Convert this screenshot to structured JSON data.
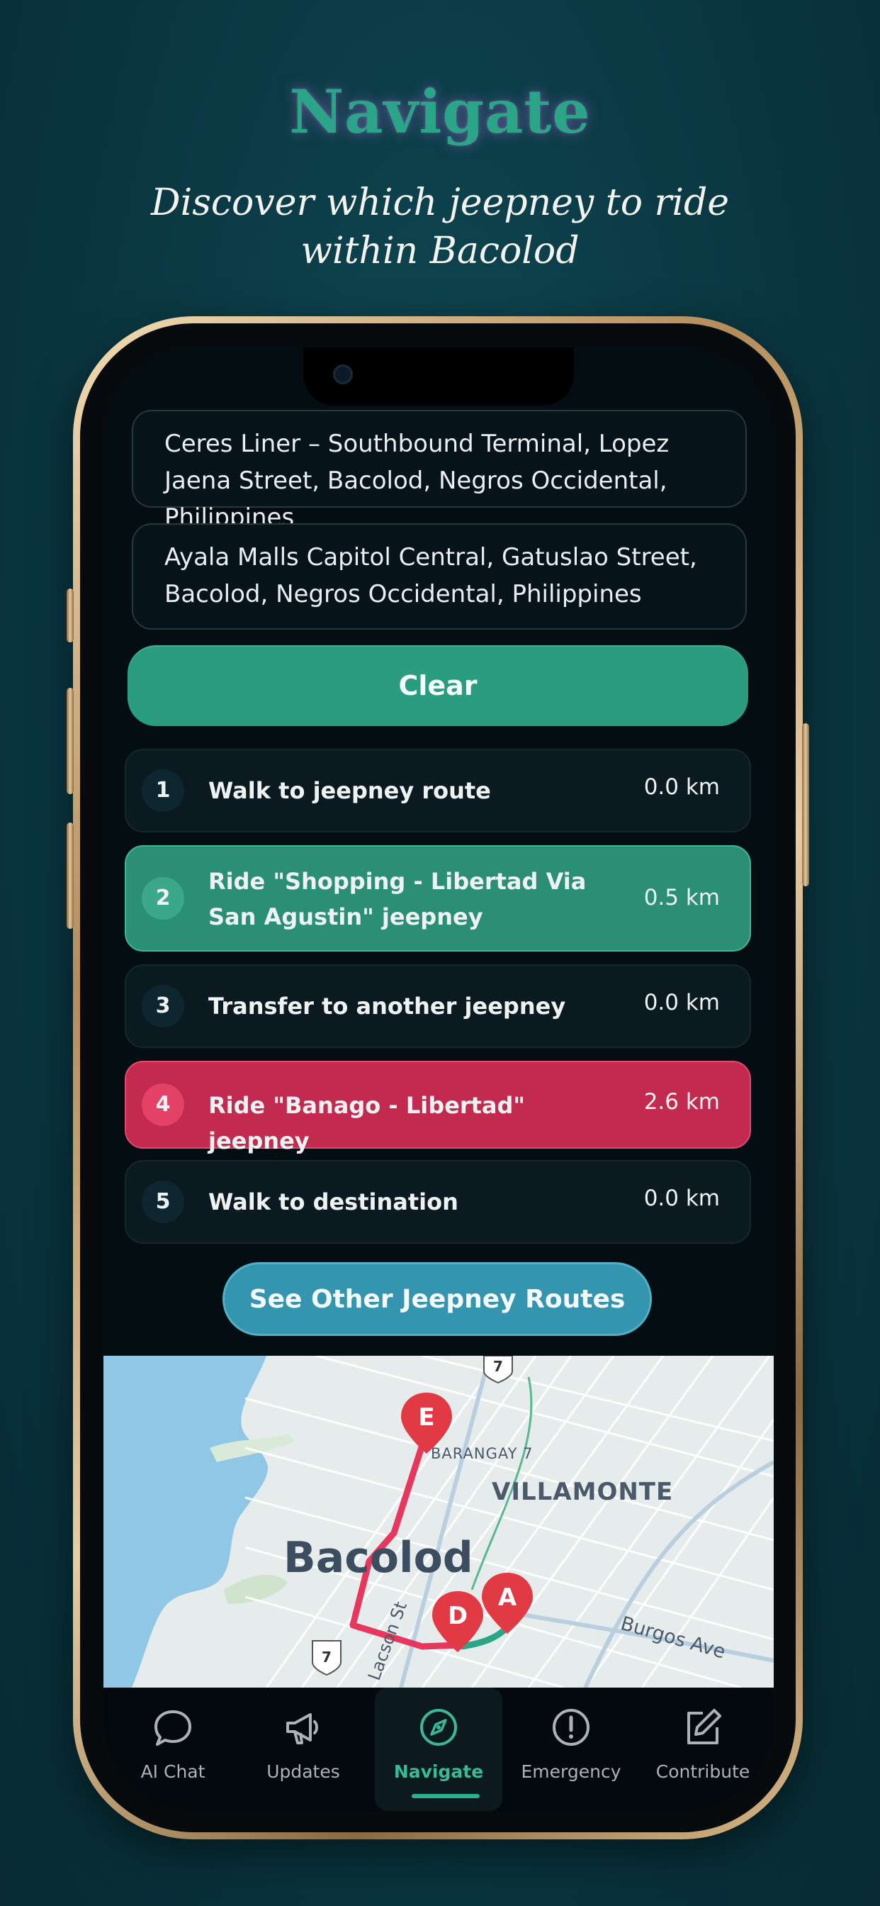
{
  "hero": {
    "title": "Navigate",
    "subtitle": "Discover which jeepney to ride within Bacolod"
  },
  "origin": {
    "value": "Ceres Liner – Southbound Terminal, Lopez Jaena Street, Bacolod, Negros Occidental, Philippines"
  },
  "destination": {
    "value": "Ayala Malls Capitol Central, Gatuslao Street, Bacolod, Negros Occidental, Philippines"
  },
  "clear_label": "Clear",
  "steps": [
    {
      "num": "1",
      "label": "Walk to jeepney route",
      "distance": "0.0 km"
    },
    {
      "num": "2",
      "label": "Ride \"Shopping - Libertad Via San Agustin\" jeepney",
      "distance": "0.5 km"
    },
    {
      "num": "3",
      "label": "Transfer to another jeepney",
      "distance": "0.0 km"
    },
    {
      "num": "4",
      "label": "Ride \"Banago - Libertad\" jeepney",
      "distance": "2.6 km"
    },
    {
      "num": "5",
      "label": "Walk to destination",
      "distance": "0.0 km"
    }
  ],
  "other_routes_label": "See Other Jeepney Routes",
  "map": {
    "city_label": "Bacolod",
    "district_label": "VILLAMONTE",
    "barangay_label": "BARANGAY 7",
    "street_label": "Burgos Ave",
    "street2_label": "Lacson St",
    "highway_shield": "7",
    "highway_shield2": "7",
    "markers": [
      "E",
      "D",
      "A"
    ],
    "route_colors": {
      "red": "#e8375d",
      "green": "#2aa587"
    }
  },
  "tabs": [
    {
      "label": "AI Chat",
      "icon": "chat-bubble-icon"
    },
    {
      "label": "Updates",
      "icon": "megaphone-icon"
    },
    {
      "label": "Navigate",
      "icon": "compass-icon",
      "active": true
    },
    {
      "label": "Emergency",
      "icon": "alert-circle-icon"
    },
    {
      "label": "Contribute",
      "icon": "edit-icon"
    }
  ]
}
